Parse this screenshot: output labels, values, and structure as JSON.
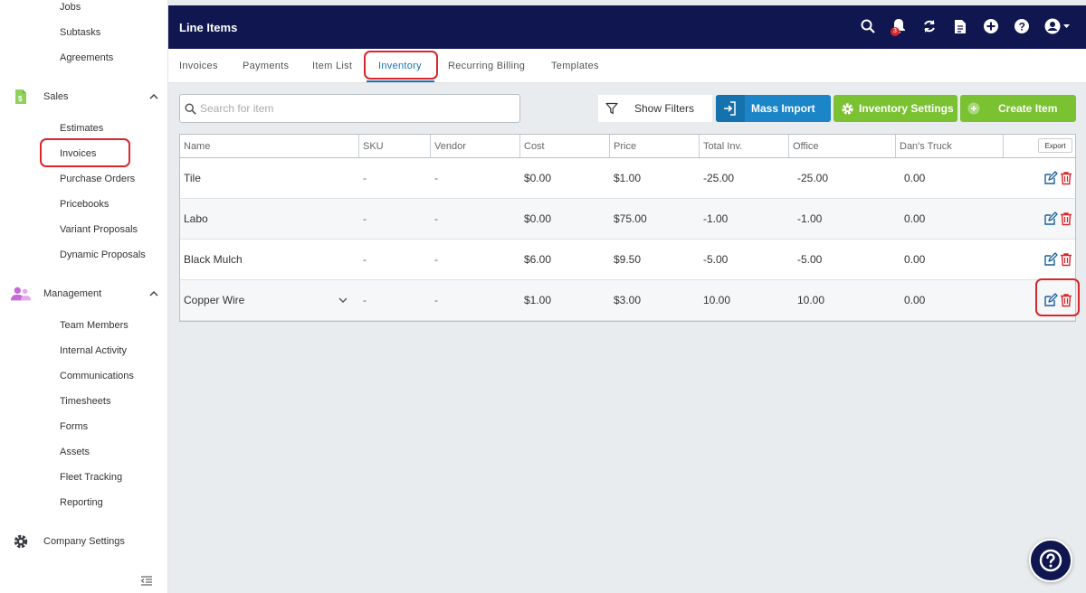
{
  "sidebar": {
    "jobs_items": [
      "Jobs",
      "Subtasks",
      "Agreements"
    ],
    "sales": {
      "label": "Sales",
      "items": [
        "Estimates",
        "Invoices",
        "Purchase Orders",
        "Pricebooks",
        "Variant Proposals",
        "Dynamic Proposals"
      ]
    },
    "management": {
      "label": "Management",
      "items": [
        "Team Members",
        "Internal Activity",
        "Communications",
        "Timesheets",
        "Forms",
        "Assets",
        "Fleet Tracking",
        "Reporting"
      ]
    },
    "company_settings": "Company Settings"
  },
  "header": {
    "title": "Line Items",
    "notification_count": "3"
  },
  "tabs": [
    "Invoices",
    "Payments",
    "Item List",
    "Inventory",
    "Recurring Billing",
    "Templates"
  ],
  "active_tab": "Inventory",
  "toolbar": {
    "search_placeholder": "Search for item",
    "show_filters": "Show Filters",
    "mass_import": "Mass Import",
    "inventory_settings": "Inventory Settings",
    "create_item": "Create Item"
  },
  "table": {
    "columns": [
      "Name",
      "SKU",
      "Vendor",
      "Cost",
      "Price",
      "Total Inv.",
      "Office",
      "Dan's Truck"
    ],
    "export_label": "Export",
    "rows": [
      {
        "name": "Tile",
        "sku": "-",
        "vendor": "-",
        "cost": "$0.00",
        "price": "$1.00",
        "total": "-25.00",
        "office": "-25.00",
        "truck": "0.00"
      },
      {
        "name": "Labo",
        "sku": "-",
        "vendor": "-",
        "cost": "$0.00",
        "price": "$75.00",
        "total": "-1.00",
        "office": "-1.00",
        "truck": "0.00"
      },
      {
        "name": "Black Mulch",
        "sku": "-",
        "vendor": "-",
        "cost": "$6.00",
        "price": "$9.50",
        "total": "-5.00",
        "office": "-5.00",
        "truck": "0.00"
      },
      {
        "name": "Copper Wire",
        "sku": "-",
        "vendor": "-",
        "cost": "$1.00",
        "price": "$3.00",
        "total": "10.00",
        "office": "10.00",
        "truck": "0.00"
      }
    ]
  },
  "colors": {
    "header_bg": "#0f1650",
    "primary_blue": "#1b85c8",
    "green": "#7ac231",
    "highlight_red": "#d8262b"
  }
}
